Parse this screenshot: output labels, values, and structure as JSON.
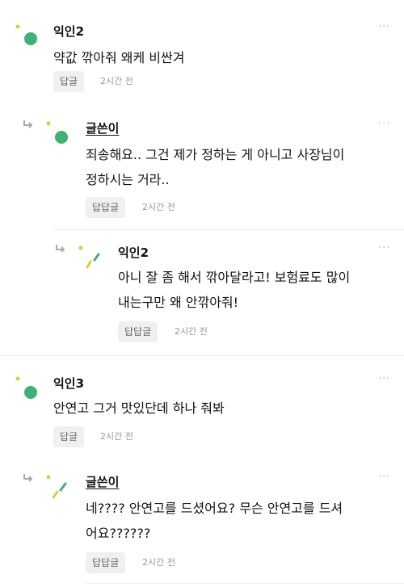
{
  "comments": [
    {
      "author": "익인2",
      "lines": [
        "약값 깎아줘 왜케 비싼겨"
      ],
      "reply_label": "답글",
      "time": "2시간 전"
    },
    {
      "author": "글쓴이",
      "lines": [
        "죄송해요.. 그건 제가 정하는 게 아니고 사장님이",
        "정하시는 거라.."
      ],
      "reply_label": "답답글",
      "time": "2시간 전"
    },
    {
      "author": "익인2",
      "lines": [
        "아니 잘 좀 해서 깎아달라고! 보험료도 많이",
        "내는구만 왜 안깎아줘!"
      ],
      "reply_label": "답답글",
      "time": "2시간 전"
    },
    {
      "author": "익인3",
      "lines": [
        "안연고 그거 맛있단데 하나 줘봐"
      ],
      "reply_label": "답글",
      "time": "2시간 전"
    },
    {
      "author": "글쓴이",
      "lines": [
        "네???? 안연고를 드셨어요? 무슨 안연고를 드셔",
        "어요??????"
      ],
      "reply_label": "답답글",
      "time": "2시간 전"
    }
  ],
  "more_label": "···",
  "colors": {
    "avatar_green": "#3cb371",
    "avatar_yellow": "#c8d63a",
    "bg": "#ffffff"
  },
  "icons": {
    "reply": "reply-arrow-icon",
    "more": "more-icon",
    "avatar": "avatar-icon"
  }
}
